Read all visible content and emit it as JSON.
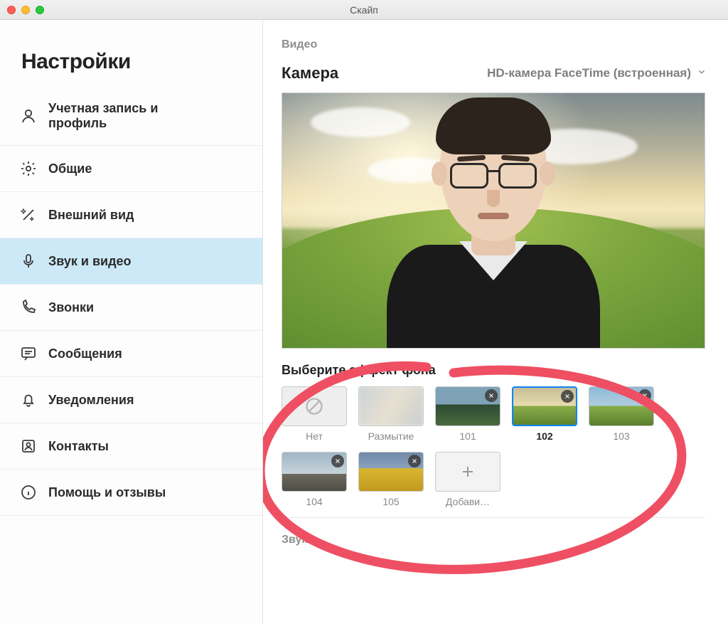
{
  "window": {
    "title": "Скайп"
  },
  "sidebar": {
    "title": "Настройки",
    "items": [
      {
        "label": "Учетная запись и профиль",
        "icon": "person"
      },
      {
        "label": "Общие",
        "icon": "gear"
      },
      {
        "label": "Внешний вид",
        "icon": "wand"
      },
      {
        "label": "Звук и видео",
        "icon": "mic",
        "active": true
      },
      {
        "label": "Звонки",
        "icon": "phone"
      },
      {
        "label": "Сообщения",
        "icon": "chat"
      },
      {
        "label": "Уведомления",
        "icon": "bell"
      },
      {
        "label": "Контакты",
        "icon": "contacts"
      },
      {
        "label": "Помощь и отзывы",
        "icon": "info"
      }
    ]
  },
  "main": {
    "video_section_label": "Видео",
    "camera_label": "Камера",
    "camera_selected": "HD-камера FaceTime (встроенная)",
    "bg_heading": "Выберите эффект фона",
    "bg_options": [
      {
        "label": "Нет",
        "kind": "none"
      },
      {
        "label": "Размытие",
        "kind": "blur"
      },
      {
        "label": "101",
        "kind": "img",
        "removable": true
      },
      {
        "label": "102",
        "kind": "img",
        "removable": true,
        "selected": true
      },
      {
        "label": "103",
        "kind": "img",
        "removable": true
      },
      {
        "label": "104",
        "kind": "img",
        "removable": true
      },
      {
        "label": "105",
        "kind": "img",
        "removable": true
      },
      {
        "label": "Добави…",
        "kind": "add"
      }
    ],
    "sound_section_label": "Звук"
  },
  "annotation": {
    "color": "#ef4f62"
  }
}
